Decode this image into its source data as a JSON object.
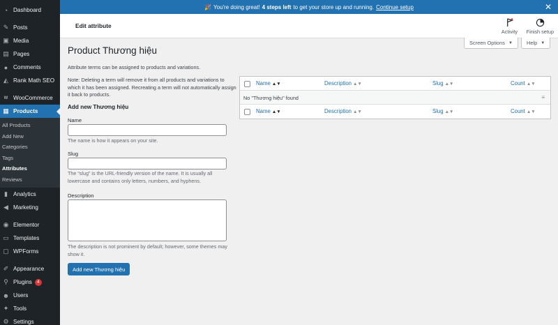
{
  "sidebar": {
    "items": [
      {
        "label": "Dashboard",
        "icon": "gauge-icon"
      },
      {
        "label": "Posts",
        "icon": "pin-icon"
      },
      {
        "label": "Media",
        "icon": "media-icon"
      },
      {
        "label": "Pages",
        "icon": "page-icon"
      },
      {
        "label": "Comments",
        "icon": "comment-icon"
      },
      {
        "label": "Rank Math SEO",
        "icon": "chart-icon"
      },
      {
        "label": "WooCommerce",
        "icon": "woo-icon"
      },
      {
        "label": "Products",
        "icon": "archive-icon"
      },
      {
        "label": "Analytics",
        "icon": "bar-chart-icon"
      },
      {
        "label": "Marketing",
        "icon": "megaphone-icon"
      },
      {
        "label": "Elementor",
        "icon": "elementor-icon"
      },
      {
        "label": "Templates",
        "icon": "folder-icon"
      },
      {
        "label": "WPForms",
        "icon": "form-icon"
      },
      {
        "label": "Appearance",
        "icon": "brush-icon"
      },
      {
        "label": "Plugins",
        "icon": "plugin-icon",
        "badge": "4"
      },
      {
        "label": "Users",
        "icon": "user-icon"
      },
      {
        "label": "Tools",
        "icon": "wrench-icon"
      },
      {
        "label": "Settings",
        "icon": "settings-icon"
      }
    ],
    "products_submenu": [
      "All Products",
      "Add New",
      "Categories",
      "Tags",
      "Attributes",
      "Reviews"
    ]
  },
  "notice": {
    "emoji": "🎉",
    "text_before": "You're doing great!",
    "bold": "4 steps left",
    "text_after": "to get your store up and running.",
    "link": "Continue setup",
    "close": "✕"
  },
  "header": {
    "title": "Edit attribute",
    "activity_label": "Activity",
    "finish_label": "Finish setup"
  },
  "screen_options": "Screen Options",
  "help": "Help",
  "page": {
    "title": "Product Thương hiệu",
    "intro": "Attribute terms can be assigned to products and variations.",
    "note": "Note: Deleting a term will remove it from all products and variations to which it has been assigned. Recreating a term will not automatically assign it back to products.",
    "form_heading": "Add new Thương hiệu",
    "name_label": "Name",
    "name_value": "",
    "name_help": "The name is how it appears on your site.",
    "slug_label": "Slug",
    "slug_value": "",
    "slug_help": "The “slug” is the URL-friendly version of the name. It is usually all lowercase and contains only letters, numbers, and hyphens.",
    "description_label": "Description",
    "description_value": "",
    "description_help": "The description is not prominent by default; however, some themes may show it.",
    "submit_label": "Add new Thương hiệu"
  },
  "table": {
    "columns": [
      "Name",
      "Description",
      "Slug",
      "Count"
    ],
    "empty_message": "No \"Thương hiệu\" found"
  },
  "colors": {
    "sidebar_bg": "#1d2327",
    "accent": "#2271b1",
    "badge": "#d63638",
    "page_bg": "#f0f0f1"
  }
}
